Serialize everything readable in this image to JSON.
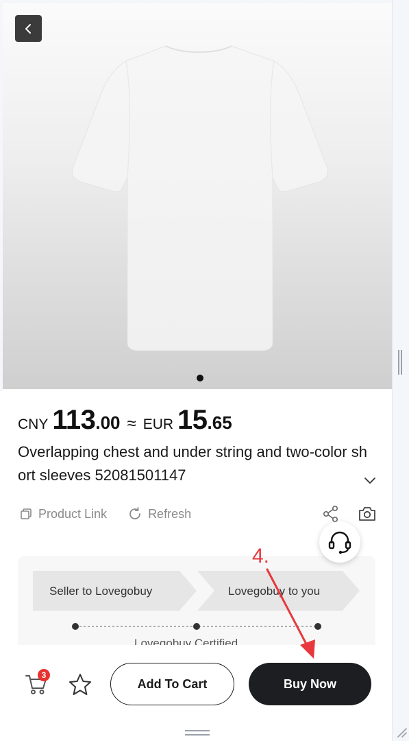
{
  "nav": {
    "back_label": "Back"
  },
  "gallery": {
    "image_count": 1,
    "active_index": 0
  },
  "price": {
    "currency_primary": "CNY",
    "amount_primary_int": "113",
    "amount_primary_dec": ".00",
    "approx_symbol": "≈",
    "currency_secondary": "EUR",
    "amount_secondary_int": "15",
    "amount_secondary_dec": ".65"
  },
  "product": {
    "title": "Overlapping chest and under string and two-color short sleeves 52081501147"
  },
  "actions": {
    "product_link": "Product Link",
    "refresh": "Refresh"
  },
  "shipping_flow": {
    "steps": [
      "Seller to Lovegobuy",
      "Lovegobuy to you"
    ],
    "certified": "Lovegobuy Certified"
  },
  "annotation": {
    "label": "4.",
    "color": "#e8383d"
  },
  "bottom_bar": {
    "cart_count": "3",
    "add_to_cart": "Add To Cart",
    "buy_now": "Buy Now"
  },
  "colors": {
    "accent_dark": "#1c1e21",
    "badge_red": "#e8322f",
    "muted_text": "#8a8a8a"
  },
  "icons": [
    "chevron-left-icon",
    "chevron-down-icon",
    "copy-icon",
    "refresh-icon",
    "share-icon",
    "camera-icon",
    "headset-icon",
    "cart-icon",
    "star-icon"
  ]
}
